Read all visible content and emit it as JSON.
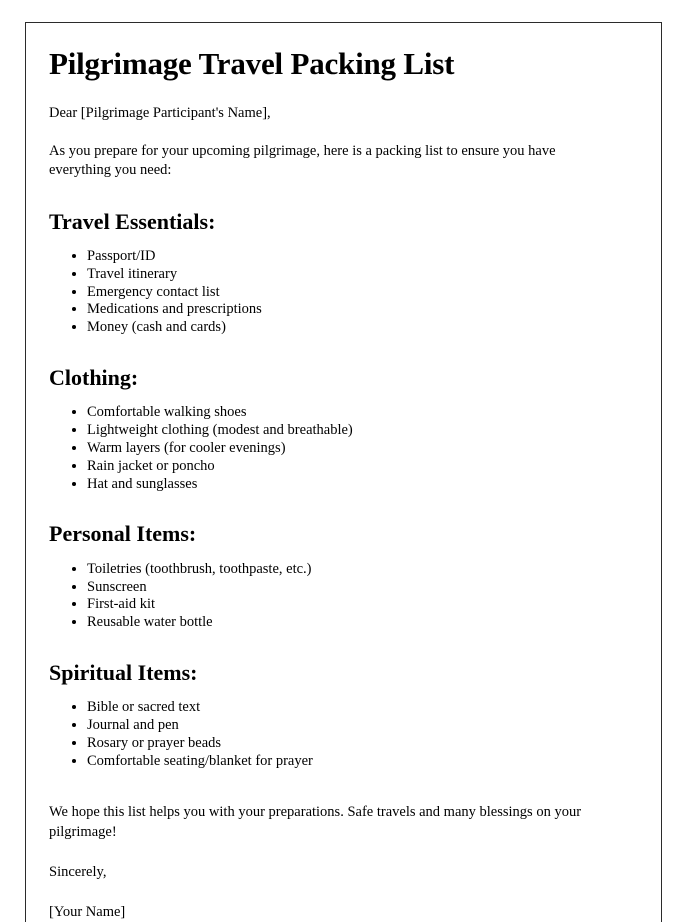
{
  "document": {
    "title": "Pilgrimage Travel Packing List",
    "salutation": "Dear [Pilgrimage Participant's Name],",
    "intro": "As you prepare for your upcoming pilgrimage, here is a packing list to ensure you have everything you need:",
    "sections": [
      {
        "heading": "Travel Essentials:",
        "items": [
          "Passport/ID",
          "Travel itinerary",
          "Emergency contact list",
          "Medications and prescriptions",
          "Money (cash and cards)"
        ]
      },
      {
        "heading": "Clothing:",
        "items": [
          "Comfortable walking shoes",
          "Lightweight clothing (modest and breathable)",
          "Warm layers (for cooler evenings)",
          "Rain jacket or poncho",
          "Hat and sunglasses"
        ]
      },
      {
        "heading": "Personal Items:",
        "items": [
          "Toiletries (toothbrush, toothpaste, etc.)",
          "Sunscreen",
          "First-aid kit",
          "Reusable water bottle"
        ]
      },
      {
        "heading": "Spiritual Items:",
        "items": [
          "Bible or sacred text",
          "Journal and pen",
          "Rosary or prayer beads",
          "Comfortable seating/blanket for prayer"
        ]
      }
    ],
    "closing": "We hope this list helps you with your preparations. Safe travels and many blessings on your pilgrimage!",
    "signoff": "Sincerely,",
    "signature": "[Your Name]"
  },
  "colors": {
    "page_background": "#ffffff",
    "text": "#000000",
    "page_border": "#2b2b2b"
  }
}
